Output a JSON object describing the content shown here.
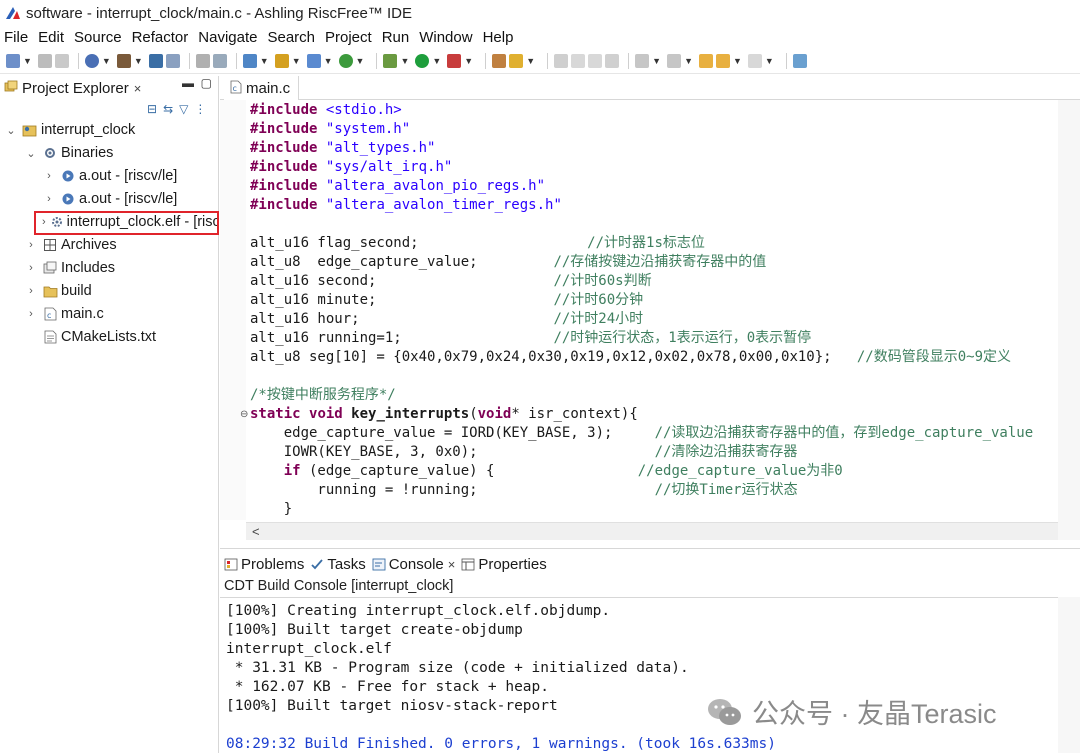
{
  "window": {
    "title": "software - interrupt_clock/main.c - Ashling RiscFree™ IDE"
  },
  "menubar": [
    "File",
    "Edit",
    "Source",
    "Refactor",
    "Navigate",
    "Search",
    "Project",
    "Run",
    "Window",
    "Help"
  ],
  "project_explorer": {
    "title": "Project Explorer",
    "close": "×",
    "tree": [
      {
        "label": "interrupt_clock",
        "icon": "project-icon",
        "twisty": "⌄"
      },
      {
        "label": "Binaries",
        "icon": "binaries-icon",
        "twisty": "⌄"
      },
      {
        "label": "a.out - [riscv/le]",
        "icon": "binary-file-icon",
        "twisty": "›"
      },
      {
        "label": "a.out - [riscv/le]",
        "icon": "binary-file-icon",
        "twisty": "›"
      },
      {
        "label": "interrupt_clock.elf - [riscv/le]",
        "icon": "elf-file-icon",
        "twisty": "›"
      },
      {
        "label": "Archives",
        "icon": "archives-icon",
        "twisty": "›"
      },
      {
        "label": "Includes",
        "icon": "includes-icon",
        "twisty": "›"
      },
      {
        "label": "build",
        "icon": "folder-icon",
        "twisty": "›"
      },
      {
        "label": "main.c",
        "icon": "c-file-icon",
        "twisty": "›"
      },
      {
        "label": "CMakeLists.txt",
        "icon": "text-file-icon",
        "twisty": ""
      }
    ]
  },
  "editor": {
    "tab_label": "main.c",
    "code_lines": [
      [
        [
          "kw",
          "#include"
        ],
        [
          "",
          " "
        ],
        [
          "str",
          "<stdio.h>"
        ]
      ],
      [
        [
          "kw",
          "#include"
        ],
        [
          "",
          " "
        ],
        [
          "str",
          "\"system.h\""
        ]
      ],
      [
        [
          "kw",
          "#include"
        ],
        [
          "",
          " "
        ],
        [
          "str",
          "\"alt_types.h\""
        ]
      ],
      [
        [
          "kw",
          "#include"
        ],
        [
          "",
          " "
        ],
        [
          "str",
          "\"sys/alt_irq.h\""
        ]
      ],
      [
        [
          "kw",
          "#include"
        ],
        [
          "",
          " "
        ],
        [
          "str",
          "\"altera_avalon_pio_regs.h\""
        ]
      ],
      [
        [
          "kw",
          "#include"
        ],
        [
          "",
          " "
        ],
        [
          "str",
          "\"altera_avalon_timer_regs.h\""
        ]
      ],
      [],
      [
        [
          "",
          "alt_u16 flag_second;                    "
        ],
        [
          "cm",
          "//计时器1s标志位"
        ]
      ],
      [
        [
          "",
          "alt_u8  edge_capture_value;         "
        ],
        [
          "cm",
          "//存储按键边沿捕获寄存器中的值"
        ]
      ],
      [
        [
          "",
          "alt_u16 second;                     "
        ],
        [
          "cm",
          "//计时60s判断"
        ]
      ],
      [
        [
          "",
          "alt_u16 minute;                     "
        ],
        [
          "cm",
          "//计时60分钟"
        ]
      ],
      [
        [
          "",
          "alt_u16 hour;                       "
        ],
        [
          "cm",
          "//计时24小时"
        ]
      ],
      [
        [
          "",
          "alt_u16 running=1;                  "
        ],
        [
          "cm",
          "//时钟运行状态，1表示运行，0表示暂停"
        ]
      ],
      [
        [
          "",
          "alt_u8 seg[10] = {0x40,0x79,0x24,0x30,0x19,0x12,0x02,0x78,0x00,0x10};   "
        ],
        [
          "cm",
          "//数码管段显示0~9定义"
        ]
      ],
      [],
      [
        [
          "cm",
          "/*按键中断服务程序*/"
        ]
      ],
      [
        [
          "kw",
          "static"
        ],
        [
          "",
          " "
        ],
        [
          "kw",
          "void"
        ],
        [
          "",
          " "
        ],
        [
          "b",
          "key_interrupts"
        ],
        [
          "",
          "("
        ],
        [
          "kw",
          "void"
        ],
        [
          "",
          "* isr_context){"
        ]
      ],
      [
        [
          "",
          "    edge_capture_value = IORD(KEY_BASE, 3);     "
        ],
        [
          "cm",
          "//读取边沿捕获寄存器中的值，存到edge_capture_value"
        ]
      ],
      [
        [
          "",
          "    IOWR(KEY_BASE, 3, 0x0);                     "
        ],
        [
          "cm",
          "//清除边沿捕获寄存器"
        ]
      ],
      [
        [
          "",
          "    "
        ],
        [
          "kw",
          "if"
        ],
        [
          "",
          " (edge_capture_value) {                 "
        ],
        [
          "cm",
          "//edge_capture_value为非0"
        ]
      ],
      [
        [
          "",
          "        running = !running;                     "
        ],
        [
          "cm",
          "//切换Timer运行状态"
        ]
      ],
      [
        [
          "",
          "    }"
        ]
      ],
      [
        [
          "",
          "}"
        ]
      ]
    ]
  },
  "console": {
    "tabs": [
      {
        "label": "Problems",
        "icon": "problems-icon"
      },
      {
        "label": "Tasks",
        "icon": "tasks-icon"
      },
      {
        "label": "Console",
        "icon": "console-icon",
        "close": "×"
      },
      {
        "label": "Properties",
        "icon": "properties-icon"
      }
    ],
    "subtitle": "CDT Build Console [interrupt_clock]",
    "lines": [
      "[100%] Creating interrupt_clock.elf.objdump.",
      "[100%] Built target create-objdump",
      "interrupt_clock.elf",
      " * 31.31 KB - Program size (code + initialized data).",
      " * 162.07 KB - Free for stack + heap.",
      "[100%] Built target niosv-stack-report",
      "",
      "08:29:32 Build Finished. 0 errors, 1 warnings. (took 16s.633ms)"
    ]
  },
  "watermark": {
    "text": "公众号 · 友晶Terasic"
  },
  "colors": {
    "keyword": "#7f0055",
    "string": "#2a00ff",
    "comment": "#3f7f5f",
    "console_status": "#1c3fd0",
    "highlight_box": "#e0242b"
  }
}
